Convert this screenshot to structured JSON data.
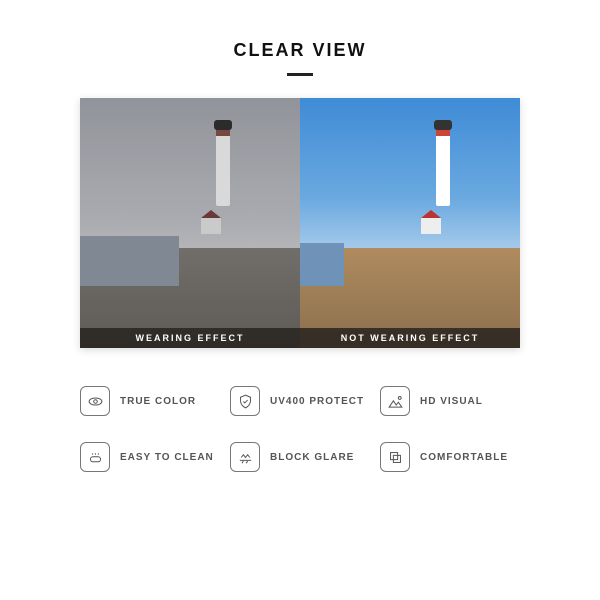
{
  "title": "CLEAR VIEW",
  "comparison": {
    "left_label": "WEARING EFFECT",
    "right_label": "NOT WEARING EFFECT"
  },
  "features": [
    {
      "icon": "eye-icon",
      "label": "TRUE COLOR"
    },
    {
      "icon": "shield-icon",
      "label": "UV400 PROTECT"
    },
    {
      "icon": "mountain-icon",
      "label": "HD VISUAL"
    },
    {
      "icon": "clean-icon",
      "label": "EASY TO CLEAN"
    },
    {
      "icon": "glare-icon",
      "label": "BLOCK GLARE"
    },
    {
      "icon": "layers-icon",
      "label": "COMFORTABLE"
    }
  ]
}
